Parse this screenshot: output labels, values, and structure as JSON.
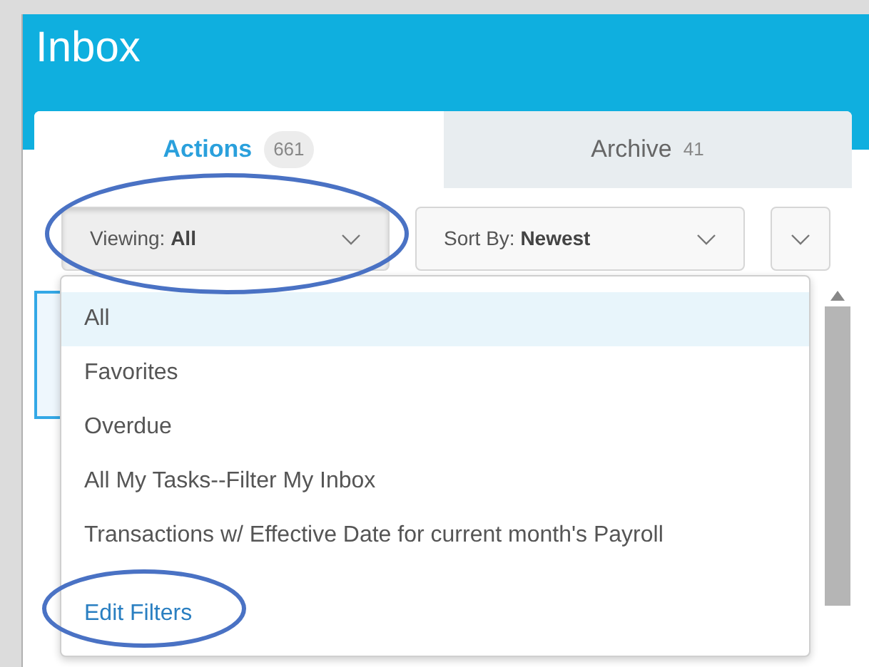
{
  "header": {
    "title": "Inbox"
  },
  "tabs": [
    {
      "label": "Actions",
      "count": "661",
      "selected": true
    },
    {
      "label": "Archive",
      "count": "41",
      "selected": false
    }
  ],
  "toolbar": {
    "viewing": {
      "label": "Viewing:",
      "value": "All",
      "expanded": true
    },
    "sort": {
      "label": "Sort By:",
      "value": "Newest"
    }
  },
  "filter_menu": {
    "items": [
      {
        "label": "All",
        "selected": true
      },
      {
        "label": "Favorites",
        "selected": false
      },
      {
        "label": "Overdue",
        "selected": false
      },
      {
        "label": "All My Tasks--Filter My Inbox",
        "selected": false
      },
      {
        "label": "Transactions w/ Effective Date for current month's Payroll",
        "selected": false
      }
    ],
    "edit_link": "Edit Filters"
  }
}
